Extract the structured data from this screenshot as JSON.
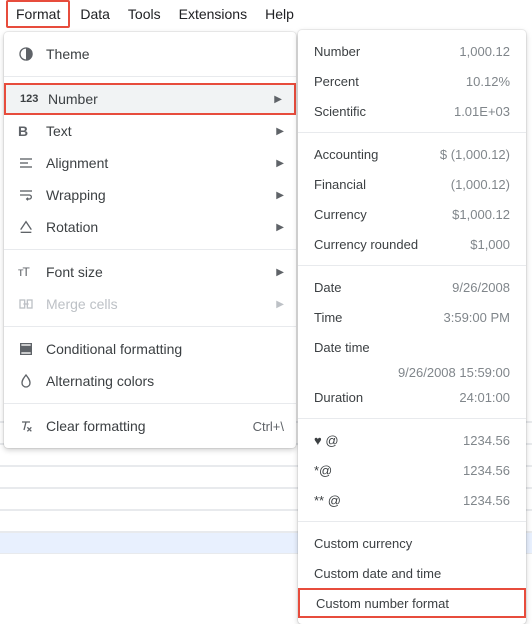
{
  "menubar": {
    "format": "Format",
    "data_": "Data",
    "tools": "Tools",
    "extensions": "Extensions",
    "help": "Help"
  },
  "formatMenu": {
    "theme": "Theme",
    "number": "Number",
    "text": "Text",
    "alignment": "Alignment",
    "wrapping": "Wrapping",
    "rotation": "Rotation",
    "fontSize": "Font size",
    "mergeCells": "Merge cells",
    "conditionalFormatting": "Conditional formatting",
    "alternatingColors": "Alternating colors",
    "clearFormatting": "Clear formatting",
    "clearFormattingShortcut": "Ctrl+\\"
  },
  "numberMenu": {
    "number": {
      "label": "Number",
      "sample": "1,000.12"
    },
    "percent": {
      "label": "Percent",
      "sample": "10.12%"
    },
    "scientific": {
      "label": "Scientific",
      "sample": "1.01E+03"
    },
    "accounting": {
      "label": "Accounting",
      "sample": "$ (1,000.12)"
    },
    "financial": {
      "label": "Financial",
      "sample": "(1,000.12)"
    },
    "currency": {
      "label": "Currency",
      "sample": "$1,000.12"
    },
    "currencyRounded": {
      "label": "Currency rounded",
      "sample": "$1,000"
    },
    "date": {
      "label": "Date",
      "sample": "9/26/2008"
    },
    "time": {
      "label": "Time",
      "sample": "3:59:00 PM"
    },
    "dateTime": {
      "label": "Date time",
      "sample": "9/26/2008 15:59:00"
    },
    "duration": {
      "label": "Duration",
      "sample": "24:01:00"
    },
    "fmt1": {
      "label": "♥ @",
      "sample": "1234.56"
    },
    "fmt2": {
      "label": "*@",
      "sample": "1234.56"
    },
    "fmt3": {
      "label": "** @",
      "sample": "1234.56"
    },
    "customCurrency": "Custom currency",
    "customDateTime": "Custom date and time",
    "customNumberFormat": "Custom number format"
  }
}
